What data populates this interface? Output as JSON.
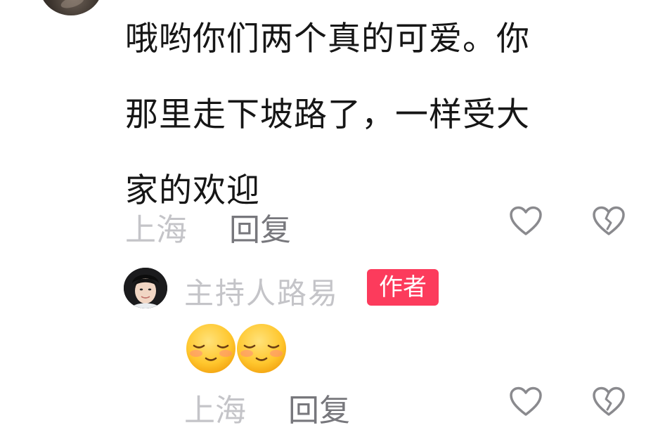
{
  "comment": {
    "lines": [
      "哦哟你们两个真的可爱。你",
      "那里走下坡路了，一样受大",
      "家的欢迎"
    ],
    "location": "上海",
    "reply_label": "回复"
  },
  "reply": {
    "author_name": "主持人路易",
    "author_badge": "作者",
    "emojis": [
      "shy-face-emoji",
      "shy-face-emoji"
    ],
    "location": "上海",
    "reply_label": "回复"
  },
  "colors": {
    "badge_bg": "#fc3b5c",
    "muted_text": "#c4c4c8",
    "reply_text": "#77777c",
    "body_text": "#161616"
  }
}
